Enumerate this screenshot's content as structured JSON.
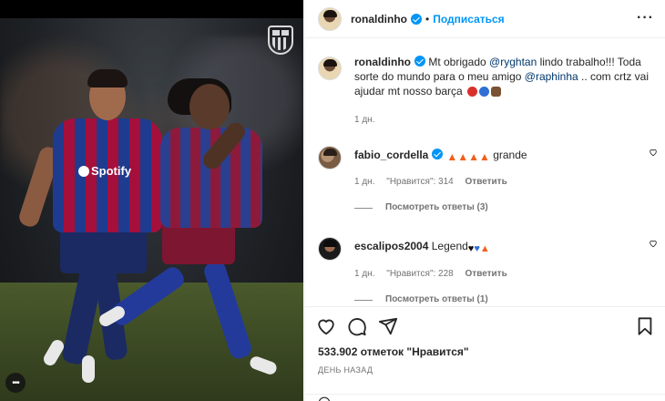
{
  "colors": {
    "accent": "#0095f6",
    "link": "#00376b",
    "muted": "#737373",
    "text": "#262626"
  },
  "photo": {
    "sponsor": "Spotify",
    "crest_icon": "fc-barcelona-crest-icon"
  },
  "header": {
    "username": "ronaldinho",
    "separator": "•",
    "follow_label": "Подписаться",
    "more_icon": "more-horizontal-icon"
  },
  "caption": {
    "username": "ronaldinho",
    "text_1": " Mt obrigado ",
    "mention_1": "@ryghtan",
    "text_2": " lindo trabalho!!! Toda sorte do mundo para o meu amigo ",
    "mention_2": "@raphinha",
    "text_3": " .. com crtz vai ajudar mt nosso barça ",
    "time": "1 дн."
  },
  "comments": [
    {
      "username": "fabio_cordella",
      "text": " grande",
      "time": "1 дн.",
      "likes": "\"Нравится\": 314",
      "reply_label": "Ответить",
      "view_replies": "Посмотреть ответы (3)"
    },
    {
      "username": "escalipos2004",
      "text": "Legend",
      "time": "1 дн.",
      "likes": "\"Нравится\": 228",
      "reply_label": "Ответить",
      "view_replies": "Посмотреть ответы (1)"
    }
  ],
  "actions": {
    "like_count": "533.902 отметок \"Нравится\"",
    "date": "ДЕНЬ НАЗАД"
  }
}
